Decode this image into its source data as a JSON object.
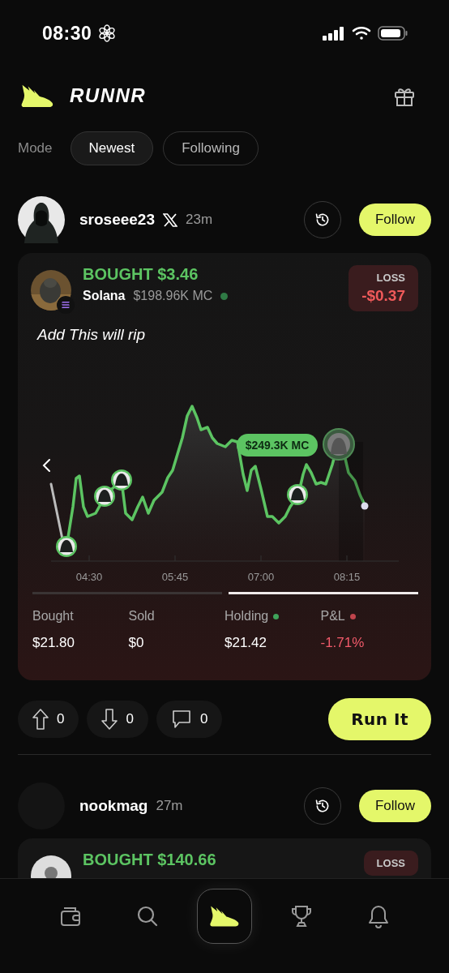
{
  "status_bar": {
    "time": "08:30"
  },
  "header": {
    "brand": "RUNNR"
  },
  "mode": {
    "label": "Mode",
    "tabs": [
      {
        "label": "Newest",
        "selected": true
      },
      {
        "label": "Following",
        "selected": false
      }
    ]
  },
  "posts": [
    {
      "user": "sroseee23",
      "x_linked": true,
      "time": "23m",
      "follow": "Follow",
      "trade": {
        "action": "BOUGHT $3.46",
        "chain": "Solana",
        "market_cap": "$198.96K MC",
        "result_label": "LOSS",
        "result_value": "-$0.37",
        "comment": "Add This will rip",
        "chart": {
          "price_label": "$249.3K MC",
          "time_labels": [
            "04:30",
            "05:45",
            "07:00",
            "08:15"
          ]
        },
        "range_segments": [
          {
            "selected": false
          },
          {
            "selected": true
          }
        ],
        "stats": [
          {
            "label": "Bought",
            "value": "$21.80"
          },
          {
            "label": "Sold",
            "value": "$0"
          },
          {
            "label": "Holding",
            "value": "$21.42",
            "color": "#3fa35a"
          },
          {
            "label": "P&L",
            "value": "-1.71%",
            "color": "#c0444c"
          }
        ]
      },
      "actions": [
        {
          "kind": "upvote",
          "count": "0"
        },
        {
          "kind": "downvote",
          "count": "0"
        },
        {
          "kind": "comment",
          "count": "0"
        }
      ],
      "cta": "Run It"
    },
    {
      "user": "nookmag",
      "x_linked": false,
      "time": "27m",
      "follow": "Follow",
      "trade": {
        "action": "BOUGHT $140.66",
        "result_label": "LOSS"
      }
    }
  ],
  "nav": [
    {
      "kind": "wallet",
      "selected": false
    },
    {
      "kind": "search",
      "selected": false
    },
    {
      "kind": "home",
      "selected": true
    },
    {
      "kind": "trophy",
      "selected": false
    },
    {
      "kind": "bell",
      "selected": false
    }
  ]
}
